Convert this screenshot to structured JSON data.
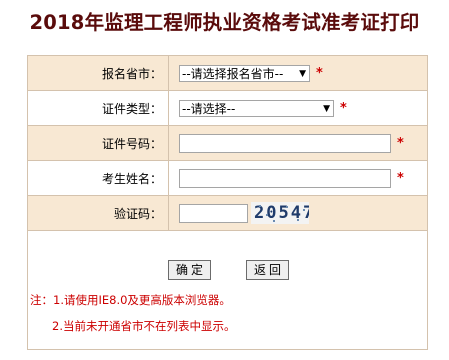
{
  "title": "2018年监理工程师执业资格考试准考证打印",
  "form": {
    "province": {
      "label": "报名省市：",
      "value": "--请选择报名省市--"
    },
    "id_type": {
      "label": "证件类型：",
      "value": "--请选择--"
    },
    "id_number": {
      "label": "证件号码：",
      "value": ""
    },
    "name": {
      "label": "考生姓名：",
      "value": ""
    },
    "captcha": {
      "label": "验证码：",
      "value": "",
      "image_text": "20547"
    },
    "required_mark": "*"
  },
  "buttons": {
    "confirm": "确定",
    "back": "返回"
  },
  "notes": {
    "line1": "注：1.请使用IE8.0及更高版本浏览器。",
    "line2": "2.当前未开通省市不在列表中显示。"
  },
  "colors": {
    "title": "#5a0b0b",
    "row_alt": "#f8e8d3",
    "border": "#d4c2ad",
    "required": "#cc0000"
  }
}
